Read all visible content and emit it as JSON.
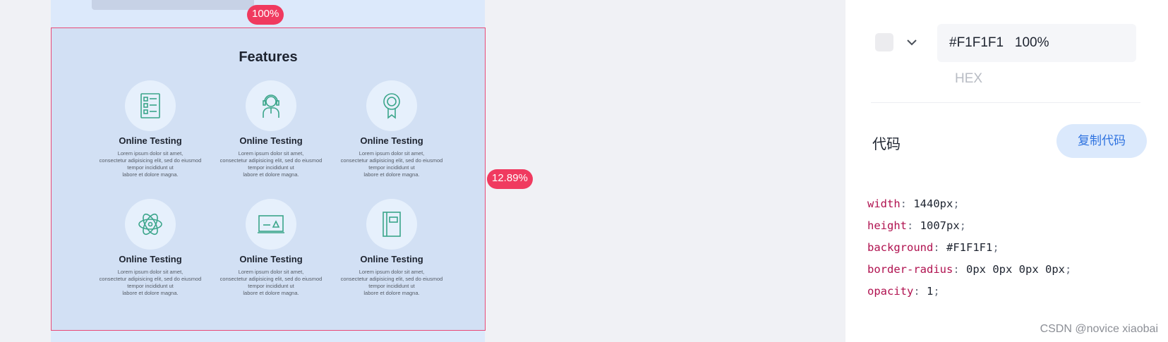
{
  "canvas": {
    "zoom_badge": "100%",
    "percent_badge": "12.89%",
    "section": {
      "title": "Features",
      "features": [
        {
          "icon": "checklist-icon",
          "title": "Online Testing",
          "desc": "Lorem ipsum dolor sit amet,\nconsectetur adipisicing elit, sed do eiusmod\ntempor incididunt ut\nlabore et dolore magna."
        },
        {
          "icon": "support-person-icon",
          "title": "Online Testing",
          "desc": "Lorem ipsum dolor sit amet,\nconsectetur adipisicing elit, sed do eiusmod\ntempor incididunt ut\nlabore et dolore magna."
        },
        {
          "icon": "award-badge-icon",
          "title": "Online Testing",
          "desc": "Lorem ipsum dolor sit amet,\nconsectetur adipisicing elit, sed do eiusmod\ntempor incididunt ut\nlabore et dolore magna."
        },
        {
          "icon": "atom-icon",
          "title": "Online Testing",
          "desc": "Lorem ipsum dolor sit amet,\nconsectetur adipisicing elit, sed do eiusmod\ntempor incididunt ut\nlabore et dolore magna."
        },
        {
          "icon": "whiteboard-icon",
          "title": "Online Testing",
          "desc": "Lorem ipsum dolor sit amet,\nconsectetur adipisicing elit, sed do eiusmod\ntempor incididunt ut\nlabore et dolore magna."
        },
        {
          "icon": "book-icon",
          "title": "Online Testing",
          "desc": "Lorem ipsum dolor sit amet,\nconsectetur adipisicing elit, sed do eiusmod\ntempor incididunt ut\nlabore et dolore magna."
        }
      ]
    }
  },
  "panel": {
    "color_value": "#F1F1F1   100%",
    "color_mode": "HEX",
    "code_label": "代码",
    "copy_button": "复制代码",
    "code": [
      {
        "prop": "width",
        "value": "1440px"
      },
      {
        "prop": "height",
        "value": "1007px"
      },
      {
        "prop": "background",
        "value": "#F1F1F1"
      },
      {
        "prop": "border-radius",
        "value": "0px 0px 0px 0px"
      },
      {
        "prop": "opacity",
        "value": "1"
      }
    ]
  },
  "watermark": "CSDN @novice xiaobai",
  "colors": {
    "accent": "#f03a5f",
    "icon_green": "#3aa58a",
    "link_blue": "#2f73e0"
  }
}
